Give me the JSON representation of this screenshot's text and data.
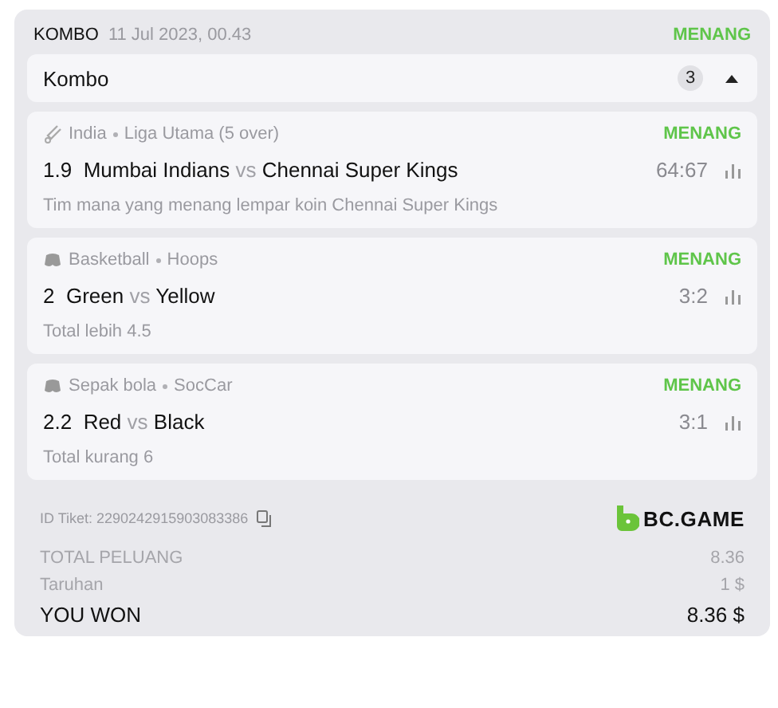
{
  "header": {
    "type": "KOMBO",
    "date": "11 Jul 2023, 00.43",
    "status": {
      "label": "MENANG",
      "kind": "won"
    }
  },
  "combo": {
    "title": "Kombo",
    "count": "3",
    "expanded": true
  },
  "bets": [
    {
      "kind": "cricket",
      "sport": "India",
      "league": "Liga Utama (5 over)",
      "status": {
        "label": "MENANG",
        "kind": "won"
      },
      "odds": "1.9",
      "home": "Mumbai Indians",
      "vs": "vs",
      "away": "Chennai Super Kings",
      "score": "64:67",
      "market": "Tim mana yang menang lempar koin Chennai Super Kings"
    },
    {
      "kind": "virtual",
      "sport": "Basketball",
      "league": "Hoops",
      "status": {
        "label": "MENANG",
        "kind": "won"
      },
      "odds": "2",
      "home": "Green",
      "vs": "vs",
      "away": "Yellow",
      "score": "3:2",
      "market": "Total lebih 4.5"
    },
    {
      "kind": "virtual",
      "sport": "Sepak bola",
      "league": "SocCar",
      "status": {
        "label": "MENANG",
        "kind": "won"
      },
      "odds": "2.2",
      "home": "Red",
      "vs": "vs",
      "away": "Black",
      "score": "3:1",
      "market": "Total kurang 6"
    }
  ],
  "ticket": {
    "label": "ID Tiket:",
    "id": "2290242915903083386"
  },
  "brand": "BC.GAME",
  "summary": [
    {
      "kind": "muted",
      "label": "TOTAL PELUANG",
      "value": "8.36"
    },
    {
      "kind": "muted",
      "label": "Taruhan",
      "value": "1 $"
    },
    {
      "kind": "total",
      "label": "YOU WON",
      "value": "8.36 $"
    }
  ]
}
